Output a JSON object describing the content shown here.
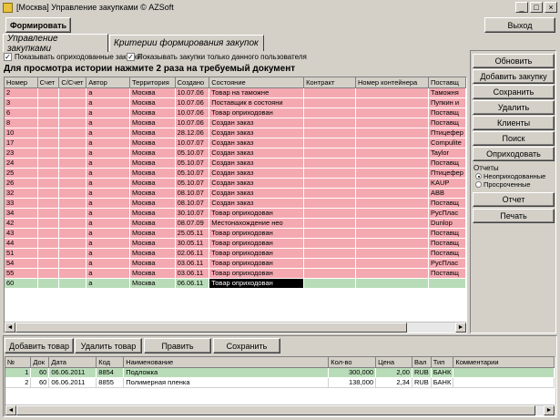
{
  "window": {
    "title": "[Москва] Управление закупками   © AZSoft",
    "min": "_",
    "max": "□",
    "close": "×"
  },
  "toolbar": {
    "form_label": "Формировать",
    "exit_label": "Выход"
  },
  "tabs": [
    {
      "label": "Управление закупками"
    },
    {
      "label": "Критерии формирования закупок"
    }
  ],
  "options": {
    "show_received": {
      "label": "Показывать оприходованные закупки",
      "checked": "✓"
    },
    "show_only_user": {
      "label": "Показывать закупки только данного пользователя",
      "checked": "✓"
    }
  },
  "hint": "Для просмотра истории нажмите 2 раза на требуемый документ",
  "purchases": {
    "columns": [
      "Номер",
      "Счет",
      "С/Счет",
      "Автор",
      "Территория",
      "Создано",
      "Состояние",
      "Контракт",
      "Номер контейнера",
      "Поставщ"
    ],
    "rows": [
      {
        "num": "2",
        "author": "a",
        "territory": "Москва",
        "created": "10.07.06",
        "state": "Товар на таможне",
        "supplier": "Таможня",
        "style": "pink"
      },
      {
        "num": "3",
        "author": "a",
        "territory": "Москва",
        "created": "10.07.06",
        "state": "Поставщик в состояни",
        "supplier": "Пупкин и",
        "style": "pink"
      },
      {
        "num": "6",
        "author": "a",
        "territory": "Москва",
        "created": "10.07.06",
        "state": "Товар оприходован",
        "supplier": "Поставщ",
        "style": "pink"
      },
      {
        "num": "8",
        "author": "a",
        "territory": "Москва",
        "created": "10.07.06",
        "state": "Создан заказ",
        "supplier": "Поставщ",
        "style": "pink"
      },
      {
        "num": "10",
        "author": "a",
        "territory": "Москва",
        "created": "28.12.06",
        "state": "Создан заказ",
        "supplier": "Птицефер",
        "style": "pink"
      },
      {
        "num": "17",
        "author": "a",
        "territory": "Москва",
        "created": "10.07.07",
        "state": "Создан заказ",
        "supplier": "Compulite",
        "style": "pink"
      },
      {
        "num": "23",
        "author": "a",
        "territory": "Москва",
        "created": "05.10.07",
        "state": "Создан заказ",
        "supplier": "Taylor",
        "style": "pink"
      },
      {
        "num": "24",
        "author": "a",
        "territory": "Москва",
        "created": "05.10.07",
        "state": "Создан заказ",
        "supplier": "Поставщ",
        "style": "pink"
      },
      {
        "num": "25",
        "author": "a",
        "territory": "Москва",
        "created": "05.10.07",
        "state": "Создан заказ",
        "supplier": "Птицефер",
        "style": "pink"
      },
      {
        "num": "26",
        "author": "a",
        "territory": "Москва",
        "created": "05.10.07",
        "state": "Создан заказ",
        "supplier": "KAUP",
        "style": "pink"
      },
      {
        "num": "32",
        "author": "a",
        "territory": "Москва",
        "created": "08.10.07",
        "state": "Создан заказ",
        "supplier": "ABB",
        "style": "pink"
      },
      {
        "num": "33",
        "author": "a",
        "territory": "Москва",
        "created": "08.10.07",
        "state": "Создан заказ",
        "supplier": "Поставщ",
        "style": "pink"
      },
      {
        "num": "34",
        "author": "a",
        "territory": "Москва",
        "created": "30.10.07",
        "state": "Товар оприходован",
        "supplier": "РусПлас",
        "style": "pink"
      },
      {
        "num": "42",
        "author": "a",
        "territory": "Москва",
        "created": "08.07.09",
        "state": "Местонахождение нео",
        "supplier": "Dunlop",
        "style": "pink"
      },
      {
        "num": "43",
        "author": "a",
        "territory": "Москва",
        "created": "25.05.11",
        "state": "Товар оприходован",
        "supplier": "Поставщ",
        "style": "pink"
      },
      {
        "num": "44",
        "author": "a",
        "territory": "Москва",
        "created": "30.05.11",
        "state": "Товар оприходован",
        "supplier": "Поставщ",
        "style": "pink"
      },
      {
        "num": "51",
        "author": "a",
        "territory": "Москва",
        "created": "02.06.11",
        "state": "Товар оприходован",
        "supplier": "Поставщ",
        "style": "pink"
      },
      {
        "num": "54",
        "author": "a",
        "territory": "Москва",
        "created": "03.06.11",
        "state": "Товар оприходован",
        "supplier": "РусПлас",
        "style": "pink"
      },
      {
        "num": "55",
        "author": "a",
        "territory": "Москва",
        "created": "03.06.11",
        "state": "Товар оприходован",
        "supplier": "Поставщ",
        "style": "pink"
      },
      {
        "num": "60",
        "author": "a",
        "territory": "Москва",
        "created": "06.06.11",
        "state": "Товар оприходован",
        "supplier": "",
        "style": "green",
        "selected_state": true
      }
    ]
  },
  "side_buttons": [
    "Обновить",
    "Добавить закупку",
    "Сохранить",
    "Удалить",
    "Клиенты",
    "Поиск",
    "Оприходовать"
  ],
  "reports": {
    "title": "Отчеты",
    "options": [
      {
        "label": "Неоприходованные",
        "selected": true
      },
      {
        "label": "Просроченные",
        "selected": false
      }
    ],
    "report_label": "Отчет",
    "print_label": "Печать"
  },
  "items_toolbar": {
    "add_label": "Добавить товар",
    "remove_label": "Удалить товар",
    "edit_label": "Править",
    "save_label": "Сохранить"
  },
  "items": {
    "columns": [
      "№",
      "Док",
      "Дата",
      "Код",
      "Наименование",
      "Кол-во",
      "Цена",
      "Вал",
      "Тип",
      "Комментарии"
    ],
    "rows": [
      {
        "n": "1",
        "doc": "60",
        "date": "06.06.2011",
        "code": "8854",
        "name": "Подложка",
        "qty": "300,000",
        "price": "2,00",
        "cur": "RUB",
        "type": "БАНК",
        "comment": "",
        "style": "green"
      },
      {
        "n": "2",
        "doc": "60",
        "date": "06.06.2011",
        "code": "8855",
        "name": "Полимерная пленка",
        "qty": "138,000",
        "price": "2,34",
        "cur": "RUB",
        "type": "БАНК",
        "comment": "",
        "style": "white"
      }
    ]
  },
  "colors": {
    "pink_row": "#f4a8b0",
    "green_row": "#b8dcb8",
    "window_bg": "#d4d0c8"
  }
}
